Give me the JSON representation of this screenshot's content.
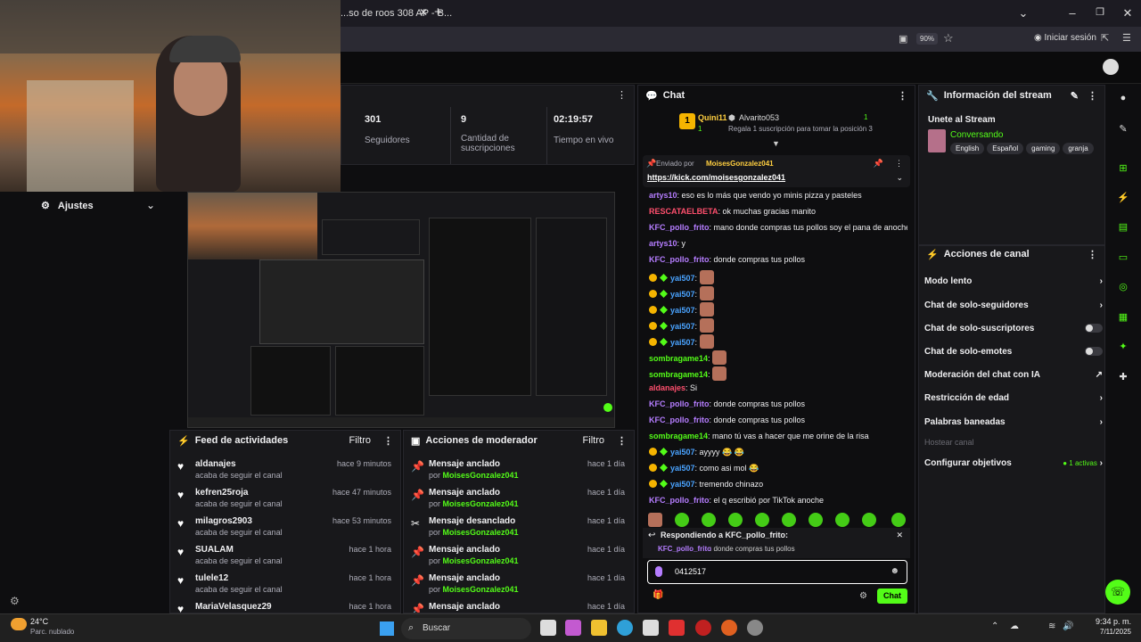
{
  "browser": {
    "tab_title": "...so de roos 308 AP - B...",
    "zoom": "90%",
    "signin": "Iniciar sesión"
  },
  "settings": {
    "label": "Ajustes"
  },
  "stats": [
    {
      "value": "301",
      "label": "Seguidores"
    },
    {
      "value": "9",
      "label": "Cantidad de suscripciones"
    },
    {
      "value": "02:19:57",
      "label": "Tiempo en vivo"
    }
  ],
  "activity": {
    "title": "Feed de actividades",
    "filter": "Filtro",
    "items": [
      {
        "name": "aldanajes",
        "sub": "acaba de seguir el canal",
        "time": "hace 9 minutos"
      },
      {
        "name": "kefren25roja",
        "sub": "acaba de seguir el canal",
        "time": "hace 47 minutos"
      },
      {
        "name": "milagros2903",
        "sub": "acaba de seguir el canal",
        "time": "hace 53 minutos"
      },
      {
        "name": "SUALAM",
        "sub": "acaba de seguir el canal",
        "time": "hace 1 hora"
      },
      {
        "name": "tulele12",
        "sub": "acaba de seguir el canal",
        "time": "hace 1 hora"
      },
      {
        "name": "MariaVelasquez29",
        "sub": "",
        "time": "hace 1 hora"
      }
    ]
  },
  "mod": {
    "title": "Acciones de moderador",
    "filter": "Filtro",
    "items": [
      {
        "action": "Mensaje anclado",
        "by": "por",
        "user": "MoisesGonzalez041",
        "time": "hace 1 día"
      },
      {
        "action": "Mensaje anclado",
        "by": "por",
        "user": "MoisesGonzalez041",
        "time": "hace 1 día"
      },
      {
        "action": "Mensaje desanclado",
        "by": "por",
        "user": "MoisesGonzalez041",
        "time": "hace 1 día"
      },
      {
        "action": "Mensaje anclado",
        "by": "por",
        "user": "MoisesGonzalez041",
        "time": "hace 1 día"
      },
      {
        "action": "Mensaje anclado",
        "by": "por",
        "user": "MoisesGonzalez041",
        "time": "hace 1 día"
      },
      {
        "action": "Mensaje anclado",
        "by": "",
        "user": "",
        "time": "hace 1 día"
      }
    ]
  },
  "chat": {
    "title": "Chat",
    "leader1": {
      "name": "Quini11",
      "count": "1"
    },
    "leader2": {
      "name": "Alvarito053",
      "count": "1",
      "sub": "Regala 1 suscripción para tomar la posición 3"
    },
    "pinned_by": "Enviado por",
    "pinned_user": "MoisesGonzalez041",
    "pinned_link": "https://kick.com/moisesgonzalez041",
    "messages": [
      {
        "user": "artys10",
        "cls": "u-purple",
        "text": ": eso es lo más que vendo yo minis pizza y pasteles"
      },
      {
        "user": "RESCATAELBETA",
        "cls": "u-red",
        "text": ": ok muchas gracias manito"
      },
      {
        "user": "KFC_pollo_frito",
        "cls": "u-purple",
        "text": ": mano donde compras tus pollos soy el pana de anoche"
      },
      {
        "user": "artys10",
        "cls": "u-purple",
        "text": ": y"
      },
      {
        "user": "KFC_pollo_frito",
        "cls": "u-purple",
        "text": ": donde compras tus pollos"
      },
      {
        "user": "yai507",
        "cls": "u-blue",
        "text": ":",
        "emote": true,
        "badges": true
      },
      {
        "user": "yai507",
        "cls": "u-blue",
        "text": ":",
        "emote": true,
        "badges": true
      },
      {
        "user": "yai507",
        "cls": "u-blue",
        "text": ":",
        "emote": true,
        "badges": true
      },
      {
        "user": "yai507",
        "cls": "u-blue",
        "text": ":",
        "emote": true,
        "badges": true
      },
      {
        "user": "yai507",
        "cls": "u-blue",
        "text": ":",
        "emote": true,
        "badges": true
      },
      {
        "user": "sombragame14",
        "cls": "u-green",
        "text": ":",
        "emote": true
      },
      {
        "user": "sombragame14",
        "cls": "u-green",
        "text": ":",
        "emote": true
      },
      {
        "user": "aldanajes",
        "cls": "u-red",
        "text": ": Si"
      },
      {
        "user": "KFC_pollo_frito",
        "cls": "u-purple",
        "text": ": donde compras tus pollos"
      },
      {
        "user": "KFC_pollo_frito",
        "cls": "u-purple",
        "text": ": donde compras tus pollos"
      },
      {
        "user": "sombragame14",
        "cls": "u-green",
        "text": ": mano tú vas a hacer que me orine de la risa"
      },
      {
        "user": "yai507",
        "cls": "u-blue",
        "text": ": ayyyy 😂 😂",
        "badges": true
      },
      {
        "user": "yai507",
        "cls": "u-blue",
        "text": ": como asi mol 😂",
        "badges": true
      },
      {
        "user": "yai507",
        "cls": "u-blue",
        "text": ": tremendo chinazo",
        "badges": true
      },
      {
        "user": "KFC_pollo_frito",
        "cls": "u-purple",
        "text": ": el q escribió por TikTok anoche"
      }
    ],
    "reply_label": "Respondiendo a KFC_pollo_frito:",
    "reply_user": "KFC_pollo_frito",
    "reply_text": ": donde compras tus pollos",
    "input_value": "0412517",
    "send": "Chat"
  },
  "stream_info": {
    "title": "Información del stream",
    "stream_title": "Unete al Stream",
    "category": "Conversando",
    "tags": [
      "English",
      "Español",
      "gaming",
      "granja"
    ]
  },
  "channel_actions": {
    "title": "Acciones de canal",
    "items": [
      {
        "label": "Modo lento",
        "kind": "arrow"
      },
      {
        "label": "Chat de solo-seguidores",
        "kind": "arrow"
      },
      {
        "label": "Chat de solo-suscriptores",
        "kind": "toggle"
      },
      {
        "label": "Chat de solo-emotes",
        "kind": "toggle"
      },
      {
        "label": "Moderación del chat con IA",
        "kind": "external"
      },
      {
        "label": "Restricción de edad",
        "kind": "arrow"
      },
      {
        "label": "Palabras baneadas",
        "kind": "arrow"
      },
      {
        "label": "Hostear canal",
        "kind": "disabled"
      },
      {
        "label": "Configurar objetivos",
        "kind": "arrow",
        "extra": "1 activas"
      }
    ]
  },
  "taskbar": {
    "weather_temp": "24°C",
    "weather_desc": "Parc. nublado",
    "search": "Buscar",
    "time": "9:34 p. m.",
    "date": "7/11/2025"
  },
  "colors": {
    "accent": "#53fc18",
    "bg": "#0e0e10",
    "panel": "#18181b"
  }
}
